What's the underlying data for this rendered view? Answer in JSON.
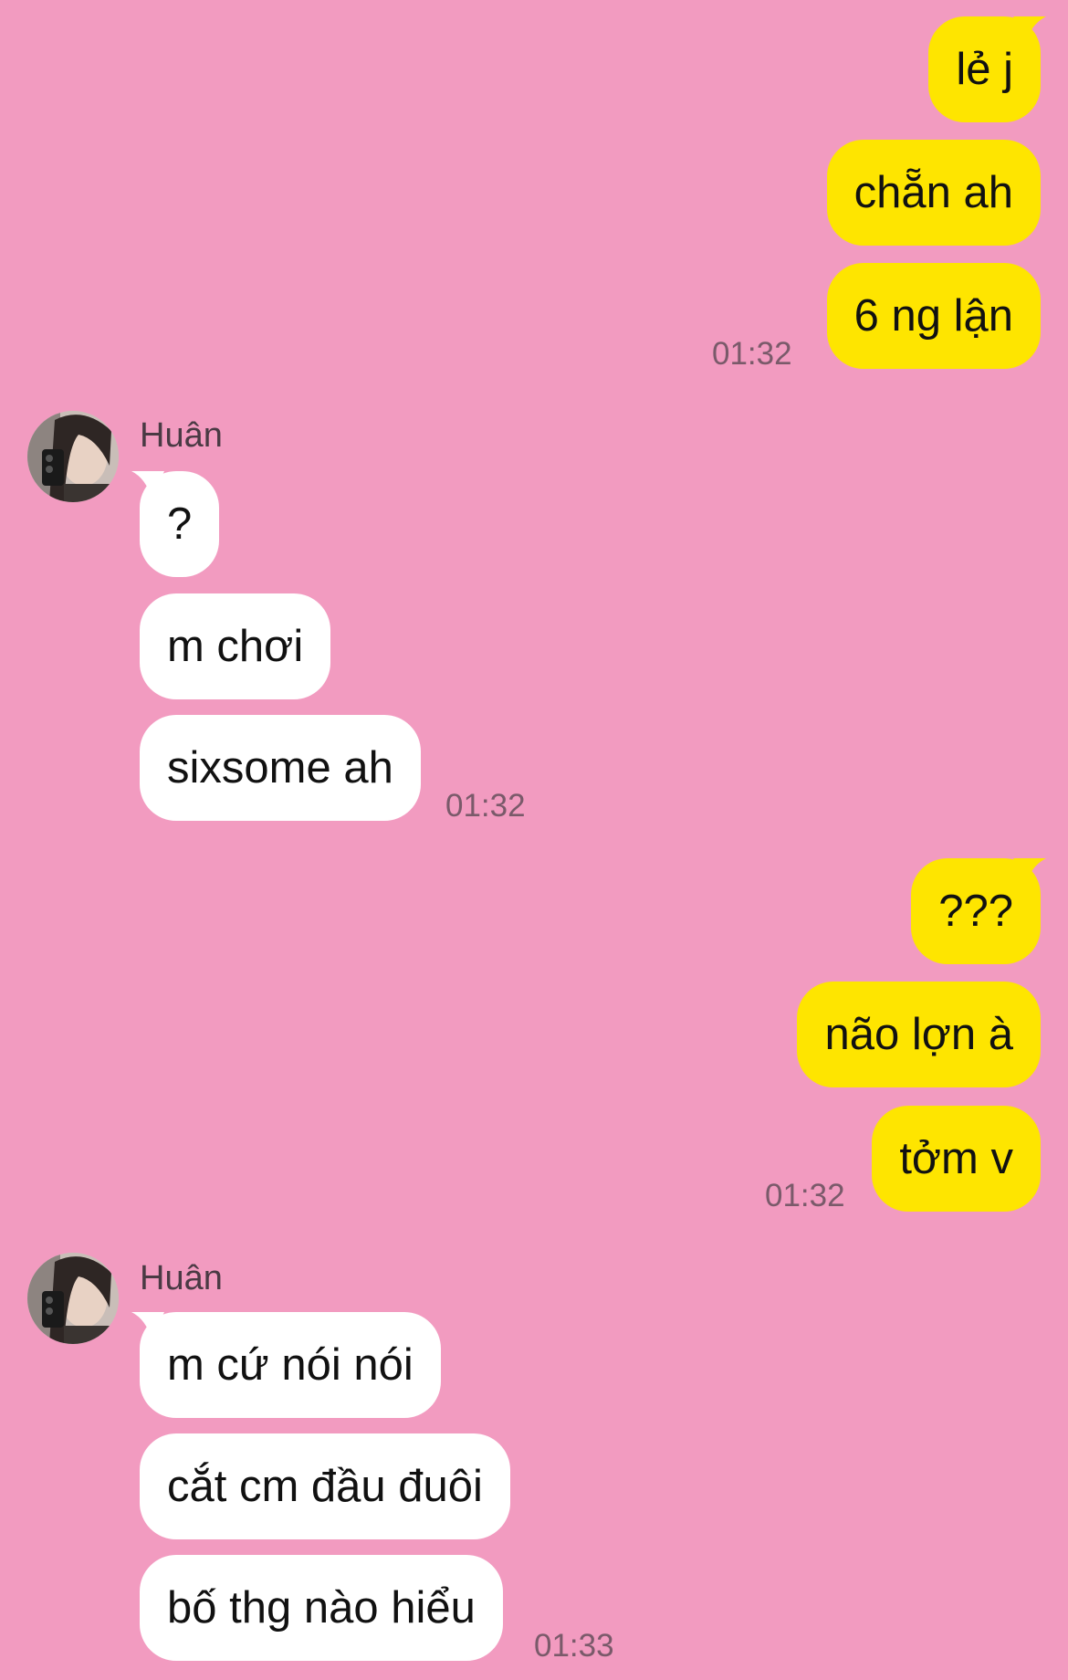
{
  "colors": {
    "background": "#f29bc0",
    "outgoing_bubble": "#fee500",
    "incoming_bubble": "#ffffff"
  },
  "messages": {
    "out1": {
      "m1": "lẻ j",
      "m2": "chẵn ah",
      "m3": "6 ng lận",
      "time": "01:32"
    },
    "in1": {
      "sender": "Huân",
      "m1": "?",
      "m2": "m chơi",
      "m3": "sixsome ah",
      "time": "01:32"
    },
    "out2": {
      "m1": "???",
      "m2": "não lợn à",
      "m3": "tởm v",
      "time": "01:32"
    },
    "in2": {
      "sender": "Huân",
      "m1": "m cứ nói nói",
      "m2": "cắt cm đầu đuôi",
      "m3": "bố thg nào hiểu",
      "time": "01:33"
    }
  }
}
